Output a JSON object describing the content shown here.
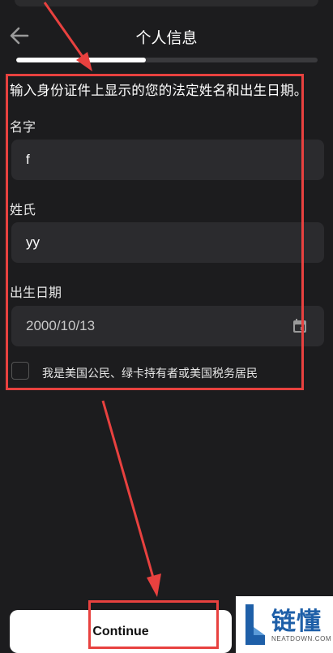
{
  "header": {
    "title": "个人信息",
    "back_icon": "arrow-left-icon"
  },
  "progress": {
    "fraction": 0.43
  },
  "form": {
    "instruction": "输入身份证件上显示的您的法定姓名和出生日期。",
    "first_name": {
      "label": "名字",
      "value": "f"
    },
    "last_name": {
      "label": "姓氏",
      "value": "yy"
    },
    "birth_date": {
      "label": "出生日期",
      "value": "2000/10/13",
      "icon": "calendar-icon"
    },
    "us_person": {
      "label": "我是美国公民、绿卡持有者或美国税务居民",
      "checked": false
    }
  },
  "footer": {
    "continue_label": "Continue"
  },
  "watermark": {
    "text": "链懂",
    "sub": "NEATDOWN.COM"
  },
  "colors": {
    "background": "#1c1c1e",
    "field": "#2b2b2e",
    "annotation": "#e8413f",
    "brand": "#1e5fa8"
  }
}
